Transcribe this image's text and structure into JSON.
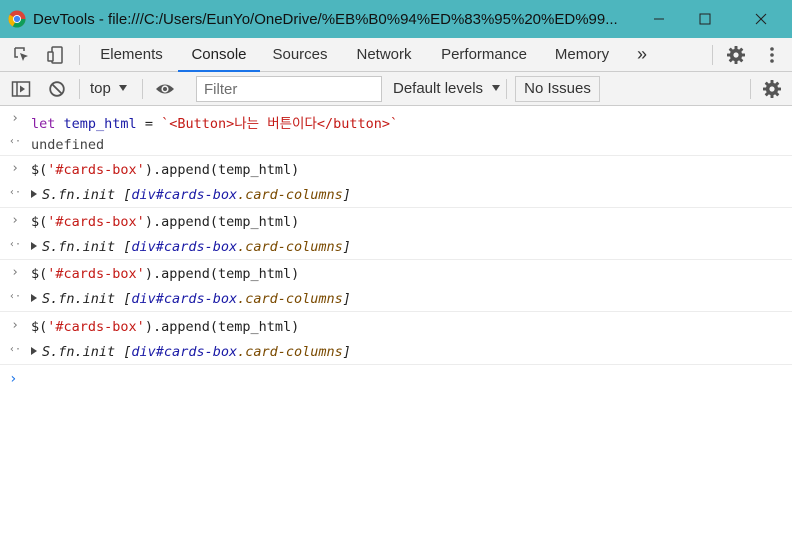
{
  "window": {
    "title": "DevTools - file:///C:/Users/EunYo/OneDrive/%EB%B0%94%ED%83%95%20%ED%99...",
    "minimize_glyph": "—",
    "maximize_glyph": "☐",
    "close_glyph": "✕",
    "accent": "#4db6be"
  },
  "tabs": {
    "items": [
      {
        "label": "Elements"
      },
      {
        "label": "Console"
      },
      {
        "label": "Sources"
      },
      {
        "label": "Network"
      },
      {
        "label": "Performance"
      },
      {
        "label": "Memory"
      }
    ],
    "more": "»",
    "active_color": "#1a73e8"
  },
  "toolbar": {
    "context": "top",
    "filter_placeholder": "Filter",
    "filter_value": "",
    "levels": "Default levels",
    "issues": "No Issues"
  },
  "console": {
    "input_1": {
      "kw": "let",
      "name": "temp_html",
      "eq": " = ",
      "value": "`<Button>나는 버튼이다</button>`"
    },
    "output_1": "undefined",
    "entries": [
      {
        "command_prefix": "$(",
        "command_arg": "'#cards-box'",
        "command_suffix": ").append(temp_html)",
        "result_prefix": "S.fn.init ",
        "result_open": "[",
        "result_tag": "div#cards-box",
        "result_class": ".card-columns",
        "result_close": "]"
      },
      {
        "command_prefix": "$(",
        "command_arg": "'#cards-box'",
        "command_suffix": ").append(temp_html)",
        "result_prefix": "S.fn.init ",
        "result_open": "[",
        "result_tag": "div#cards-box",
        "result_class": ".card-columns",
        "result_close": "]"
      },
      {
        "command_prefix": "$(",
        "command_arg": "'#cards-box'",
        "command_suffix": ").append(temp_html)",
        "result_prefix": "S.fn.init ",
        "result_open": "[",
        "result_tag": "div#cards-box",
        "result_class": ".card-columns",
        "result_close": "]"
      },
      {
        "command_prefix": "$(",
        "command_arg": "'#cards-box'",
        "command_suffix": ").append(temp_html)",
        "result_prefix": "S.fn.init ",
        "result_open": "[",
        "result_tag": "div#cards-box",
        "result_class": ".card-columns",
        "result_close": "]"
      }
    ],
    "input_glyph": "›",
    "output_glyph": "‹·",
    "prompt_glyph": "›"
  }
}
